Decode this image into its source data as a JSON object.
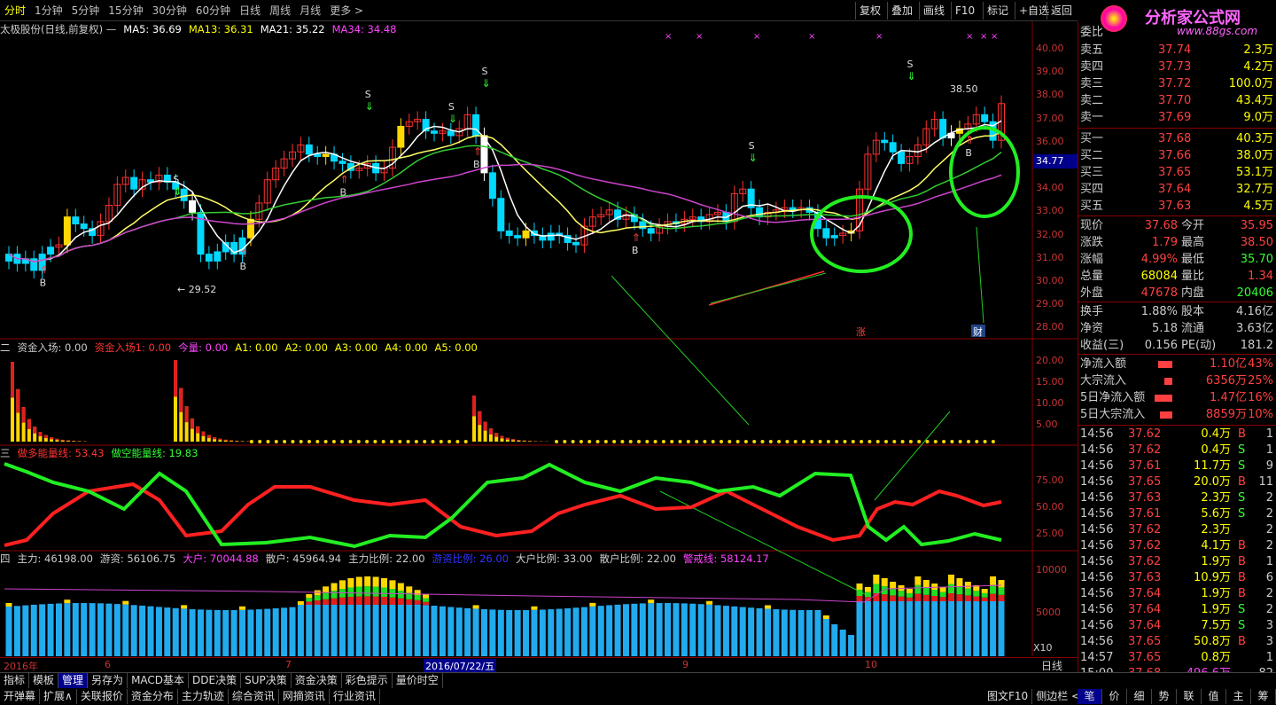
{
  "topbar": {
    "tabs": [
      "分时",
      "1分钟",
      "5分钟",
      "15分钟",
      "30分钟",
      "60分钟",
      "日线",
      "周线",
      "月线",
      "更多 >"
    ],
    "right": [
      "复权",
      "叠加",
      "画线",
      "F10",
      "标记",
      "+自选",
      "返回"
    ]
  },
  "title": {
    "stock": "太极股份(日线,前复权) —",
    "ma5": "MA5: 36.69",
    "ma13": "MA13: 36.31",
    "ma21": "MA21: 35.22",
    "ma34": "MA34: 34.48"
  },
  "price_axis": [
    "40.00",
    "39.00",
    "38.00",
    "37.00",
    "36.00",
    "35.00",
    "34.00",
    "33.00",
    "32.00",
    "31.00",
    "30.00",
    "29.00",
    "28.00"
  ],
  "current_price_tag": "34.77",
  "annotations": {
    "high": "38.50",
    "low": "← 29.52",
    "zhang": "涨",
    "cai": "财",
    "marker_b": "B",
    "marker_s": "S"
  },
  "panel2": {
    "label": "二",
    "items": [
      "资金入场: 0.00",
      "资金入场1: 0.00",
      "今量: 0.00",
      "A1: 0.00",
      "A2: 0.00",
      "A3: 0.00",
      "A4: 0.00",
      "A5: 0.00"
    ],
    "axis": [
      "20.00",
      "15.00",
      "10.00",
      "5.00"
    ]
  },
  "panel3": {
    "label": "三",
    "items": [
      "做多能量线: 53.43",
      "做空能量线: 19.83"
    ],
    "axis": [
      "75.00",
      "50.00",
      "25.00"
    ]
  },
  "panel4": {
    "label": "四",
    "items": [
      "主力: 46198.00",
      "游资: 56106.75",
      "大户: 70044.88",
      "散户: 45964.94",
      "主力比例: 22.00",
      "游资比例: 26.00",
      "大户比例: 33.00",
      "散户比例: 22.00",
      "警戒线: 58124.17"
    ],
    "axis": [
      "10000",
      "5000"
    ]
  },
  "date_axis": [
    "2016年",
    "6",
    "7",
    "2016/07/22/五",
    "9",
    "10"
  ],
  "date_axis_right": "日线",
  "x10": "X10",
  "bottom_tabs1": [
    "指标",
    "模板",
    "管理",
    "另存为",
    "MACD基本",
    "DDE决策",
    "SUP决策",
    "资金决策",
    "彩色提示",
    "量价时空"
  ],
  "bottom_tabs2": [
    "开弹幕",
    "扩展∧",
    "关联报价",
    "资金分布",
    "主力轨迹",
    "综合资讯",
    "网摘资讯",
    "行业资讯"
  ],
  "bottom_right": [
    "图文F10",
    "侧边栏 <"
  ],
  "bottom_right2": [
    "笔",
    "价",
    "细",
    "势",
    "联",
    "值",
    "主",
    "筹"
  ],
  "logo": {
    "title": "分析家公式网",
    "url": "www.88gs.com"
  },
  "quote": {
    "header": "委比",
    "sell": [
      {
        "label": "卖五",
        "price": "37.74",
        "vol": "2.3万"
      },
      {
        "label": "卖四",
        "price": "37.73",
        "vol": "4.2万"
      },
      {
        "label": "卖三",
        "price": "37.72",
        "vol": "100.0万"
      },
      {
        "label": "卖二",
        "price": "37.70",
        "vol": "43.4万"
      },
      {
        "label": "卖一",
        "price": "37.69",
        "vol": "9.0万"
      }
    ],
    "buy": [
      {
        "label": "买一",
        "price": "37.68",
        "vol": "40.3万"
      },
      {
        "label": "买二",
        "price": "37.66",
        "vol": "38.0万"
      },
      {
        "label": "买三",
        "price": "37.65",
        "vol": "53.1万"
      },
      {
        "label": "买四",
        "price": "37.64",
        "vol": "32.7万"
      },
      {
        "label": "买五",
        "price": "37.63",
        "vol": "4.5万"
      }
    ],
    "stats": [
      [
        "现价",
        "37.68",
        "今开",
        "35.95"
      ],
      [
        "涨跌",
        "1.79",
        "最高",
        "38.50"
      ],
      [
        "涨幅",
        "4.99%",
        "最低",
        "35.70"
      ],
      [
        "总量",
        "68084",
        "量比",
        "1.34"
      ],
      [
        "外盘",
        "47678",
        "内盘",
        "20406"
      ]
    ],
    "stats2": [
      [
        "换手",
        "1.88%",
        "股本",
        "4.16亿"
      ],
      [
        "净资",
        "5.18",
        "流通",
        "3.63亿"
      ],
      [
        "收益(三)",
        "0.156",
        "PE(动)",
        "181.2"
      ]
    ],
    "flow": [
      {
        "label": "净流入额",
        "val": "1.10亿",
        "pct": "43%"
      },
      {
        "label": "大宗流入",
        "val": "6356万",
        "pct": "25%"
      },
      {
        "label": "5日净流入额",
        "val": "1.47亿",
        "pct": "16%"
      },
      {
        "label": "5日大宗流入",
        "val": "8859万",
        "pct": "10%"
      }
    ],
    "ticks": [
      [
        "14:56",
        "37.62",
        "0.4万",
        "B",
        "1"
      ],
      [
        "14:56",
        "37.62",
        "0.4万",
        "S",
        "1"
      ],
      [
        "14:56",
        "37.61",
        "11.7万",
        "S",
        "9"
      ],
      [
        "14:56",
        "37.65",
        "20.0万",
        "B",
        "11"
      ],
      [
        "14:56",
        "37.63",
        "2.3万",
        "S",
        "2"
      ],
      [
        "14:56",
        "37.61",
        "5.6万",
        "S",
        "2"
      ],
      [
        "14:56",
        "37.62",
        "2.3万",
        "",
        "2"
      ],
      [
        "14:56",
        "37.62",
        "4.1万",
        "B",
        "2"
      ],
      [
        "14:56",
        "37.62",
        "1.9万",
        "B",
        "1"
      ],
      [
        "14:56",
        "37.63",
        "10.9万",
        "B",
        "6"
      ],
      [
        "14:56",
        "37.64",
        "1.9万",
        "B",
        "2"
      ],
      [
        "14:56",
        "37.64",
        "1.9万",
        "S",
        "2"
      ],
      [
        "14:56",
        "37.64",
        "7.5万",
        "S",
        "3"
      ],
      [
        "14:56",
        "37.65",
        "50.8万",
        "B",
        "3"
      ],
      [
        "14:57",
        "37.65",
        "0.8万",
        "",
        "1"
      ],
      [
        "15:00",
        "37.68",
        "496.6万",
        "",
        "82"
      ]
    ]
  },
  "chart_data": {
    "type": "candlestick",
    "title": "太极股份(日线,前复权)",
    "ylim": [
      28,
      40
    ],
    "close": [
      31.2,
      30.8,
      31.0,
      30.5,
      31.2,
      31.5,
      31.6,
      32.8,
      32.5,
      32.3,
      32.0,
      32.6,
      33.3,
      34.2,
      34.5,
      34.0,
      34.4,
      34.3,
      34.6,
      34.3,
      34.0,
      33.5,
      33.0,
      31.2,
      30.9,
      31.3,
      31.7,
      31.2,
      31.9,
      32.7,
      33.4,
      34.4,
      34.9,
      35.3,
      35.6,
      35.9,
      35.5,
      35.4,
      35.5,
      35.2,
      35.1,
      34.8,
      34.9,
      35.1,
      34.7,
      34.9,
      35.8,
      36.7,
      36.9,
      37.0,
      36.5,
      36.4,
      36.5,
      36.3,
      36.6,
      37.2,
      36.3,
      34.7,
      33.6,
      32.2,
      32.0,
      31.9,
      32.2,
      32.0,
      31.8,
      32.1,
      32.0,
      31.7,
      31.6,
      32.4,
      32.8,
      32.9,
      33.1,
      32.7,
      32.9,
      32.6,
      32.3,
      32.1,
      32.4,
      32.6,
      32.5,
      32.7,
      32.8,
      32.6,
      32.9,
      33.0,
      32.6,
      33.8,
      34.0,
      33.2,
      32.8,
      33.0,
      33.1,
      33.2,
      33.1,
      33.2,
      33.0,
      32.3,
      31.9,
      32.0,
      32.1,
      32.2,
      34.0,
      35.5,
      36.1,
      36.0,
      35.6,
      35.1,
      35.4,
      35.9,
      36.6,
      37.0,
      36.2,
      36.4,
      36.6,
      36.8,
      37.2,
      36.9,
      36.1,
      37.68
    ],
    "volume_bars": "stacked 主力/游资/大户/散户",
    "energy_lines": [
      "做多能量线",
      "做空能量线"
    ]
  }
}
